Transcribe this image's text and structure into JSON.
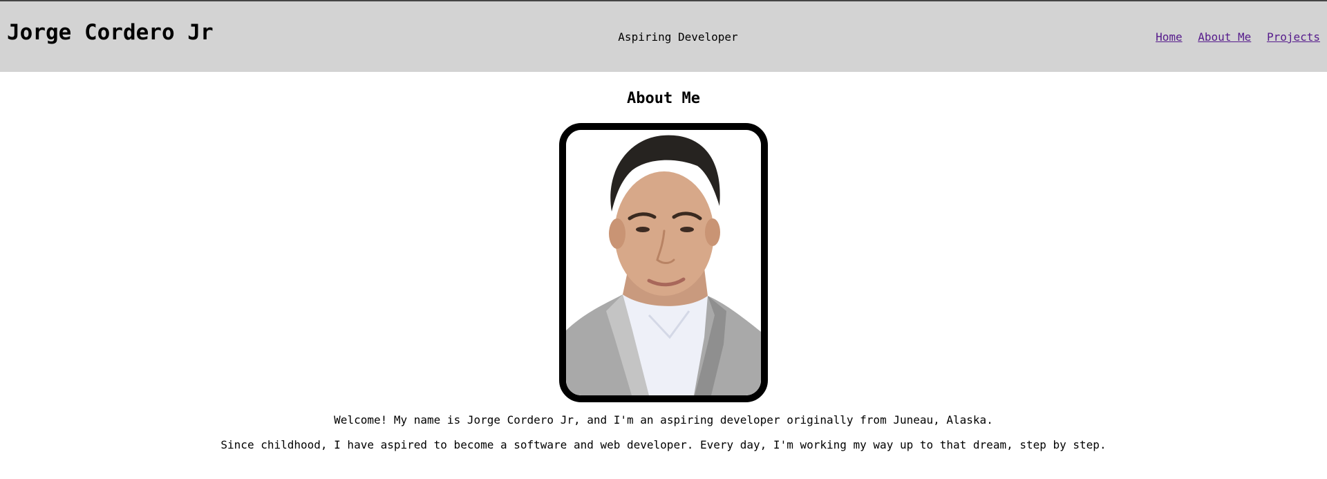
{
  "header": {
    "site_title": "Jorge Cordero Jr",
    "tagline": "Aspiring Developer",
    "nav": [
      {
        "label": "Home"
      },
      {
        "label": "About Me"
      },
      {
        "label": "Projects"
      }
    ]
  },
  "main": {
    "title": "About Me",
    "paragraphs": [
      "Welcome! My name is Jorge Cordero Jr, and I'm an aspiring developer originally from Juneau, Alaska.",
      "Since childhood, I have aspired to become a software and web developer. Every day, I'm working my way up to that dream, step by step."
    ]
  },
  "colors": {
    "header_bg": "#d3d3d3",
    "link_visited": "#551a8b",
    "photo_border": "#000000"
  }
}
